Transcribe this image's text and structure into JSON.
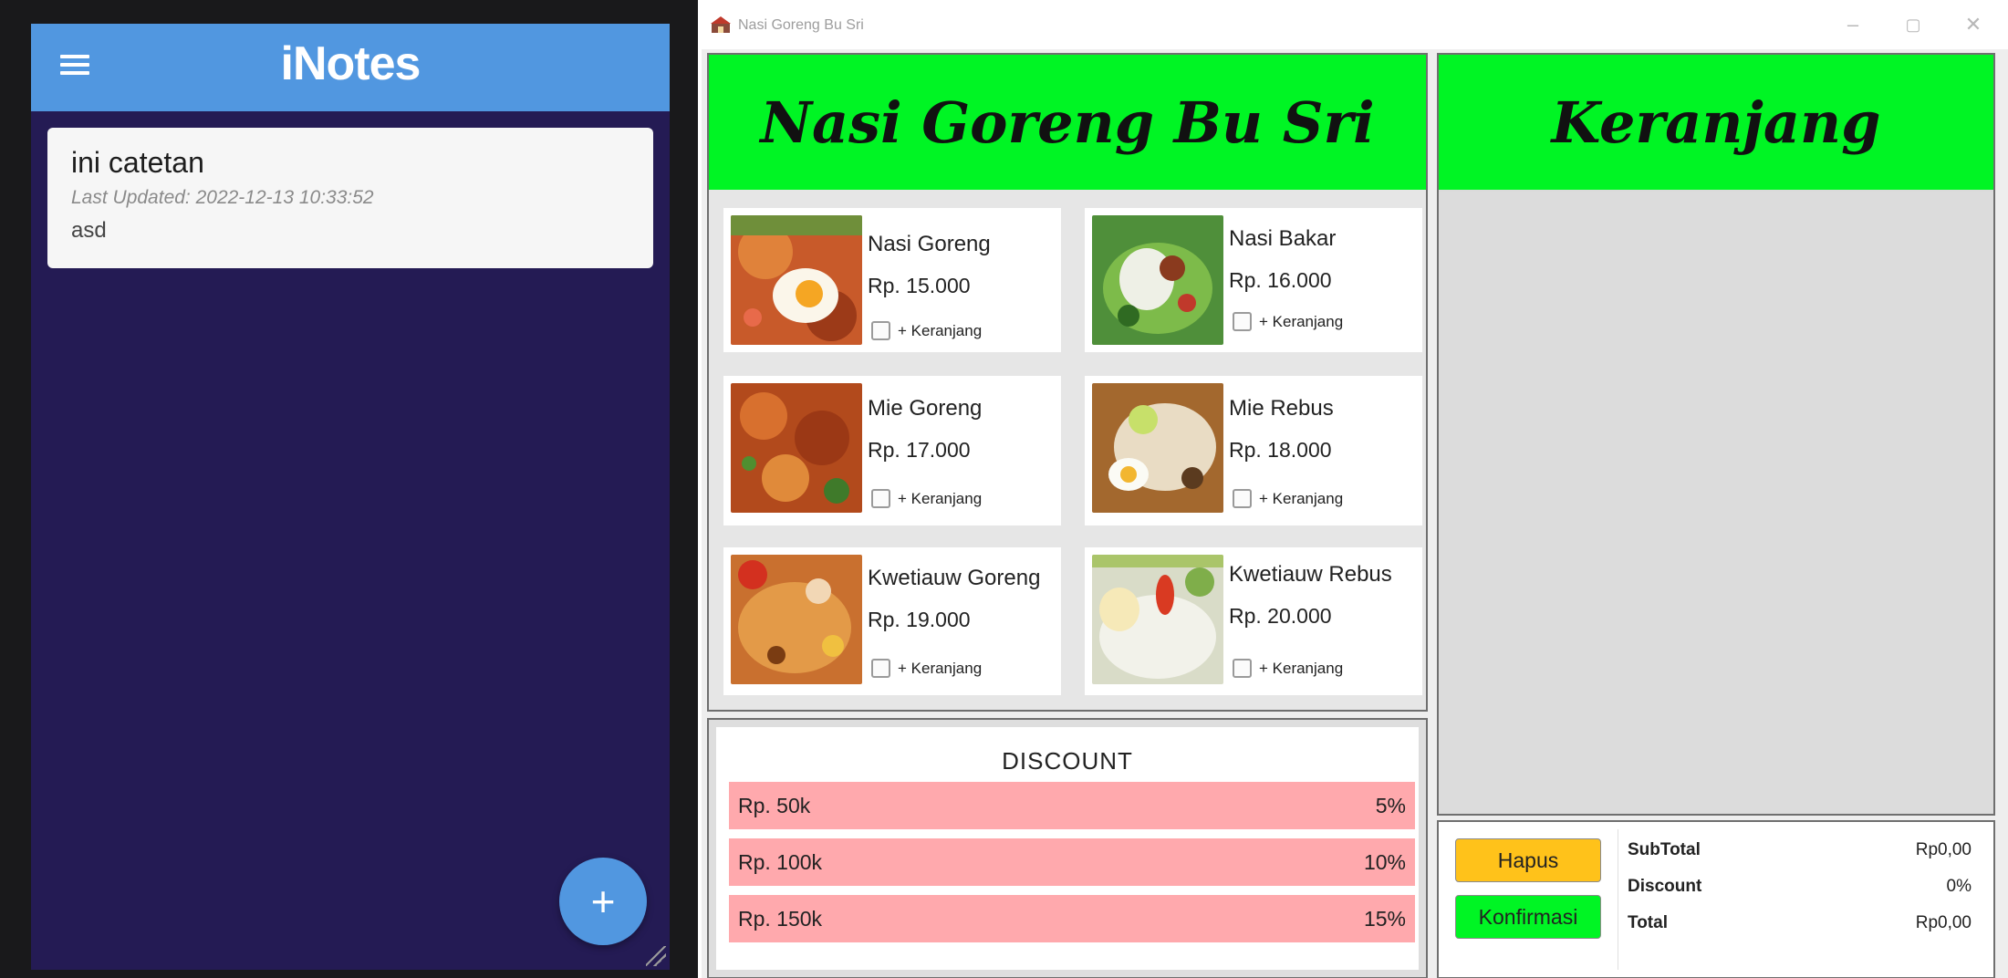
{
  "inotes": {
    "title": "iNotes",
    "notes": [
      {
        "title": "ini catetan",
        "updated": "Last Updated: 2022-12-13 10:33:52",
        "body": "asd"
      }
    ],
    "fab_label": "+"
  },
  "shop": {
    "window_title": "Nasi Goreng Bu Sri",
    "header": "Nasi Goreng Bu Sri",
    "cart_header": "Keranjang",
    "items": [
      {
        "name": "Nasi Goreng",
        "price": "Rp. 15.000",
        "add_label": "+ Keranjang"
      },
      {
        "name": "Nasi Bakar",
        "price": "Rp. 16.000",
        "add_label": "+ Keranjang"
      },
      {
        "name": "Mie Goreng",
        "price": "Rp. 17.000",
        "add_label": "+ Keranjang"
      },
      {
        "name": "Mie Rebus",
        "price": "Rp. 18.000",
        "add_label": "+ Keranjang"
      },
      {
        "name": "Kwetiauw Goreng",
        "price": "Rp. 19.000",
        "add_label": "+ Keranjang"
      },
      {
        "name": "Kwetiauw Rebus",
        "price": "Rp. 20.000",
        "add_label": "+ Keranjang"
      }
    ],
    "discount": {
      "title": "DISCOUNT",
      "rows": [
        {
          "threshold": "Rp. 50k",
          "percent": "5%"
        },
        {
          "threshold": "Rp. 100k",
          "percent": "10%"
        },
        {
          "threshold": "Rp. 150k",
          "percent": "15%"
        }
      ]
    },
    "buttons": {
      "delete": "Hapus",
      "confirm": "Konfirmasi"
    },
    "summary": {
      "subtotal_label": "SubTotal",
      "subtotal_value": "Rp0,00",
      "discount_label": "Discount",
      "discount_value": "0%",
      "total_label": "Total",
      "total_value": "Rp0,00"
    }
  },
  "colors": {
    "inotes_appbar": "#5197e0",
    "inotes_background": "#241b54",
    "header_green": "#00f524",
    "discount_row": "#ffa9ad",
    "hapus_button": "#ffc21a",
    "konfirmasi_button": "#00f524"
  }
}
